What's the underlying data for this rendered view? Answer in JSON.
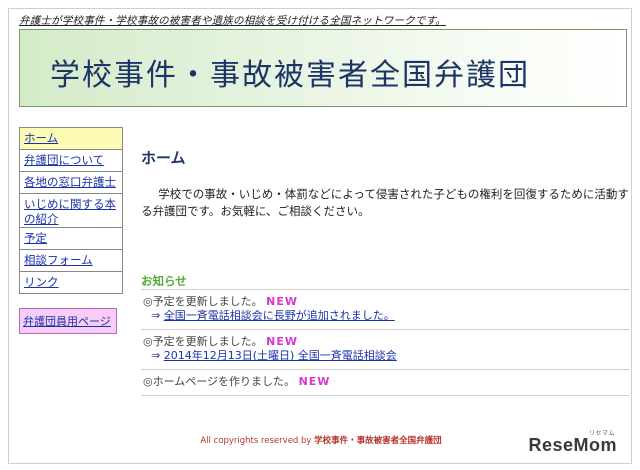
{
  "header": {
    "tagline": "弁護士が学校事件・学校事故の被害者や遺族の相談を受け付ける全国ネットワークです。",
    "title": "学校事件・事故被害者全国弁護団"
  },
  "sidebar": {
    "items": [
      {
        "label": "ホーム"
      },
      {
        "label": "弁護団について"
      },
      {
        "label": "各地の窓口弁護士"
      },
      {
        "label": "いじめに関する本の紹介"
      },
      {
        "label": "予定"
      },
      {
        "label": "相談フォーム"
      },
      {
        "label": "リンク"
      }
    ],
    "member_button": "弁護団員用ページ"
  },
  "main": {
    "title": "ホーム",
    "intro": "学校での事故・いじめ・体罰などによって侵害された子どもの権利を回復するために活動する弁護団です。お気軽に、ご相談ください。"
  },
  "news": {
    "heading": "お知らせ",
    "new_label": "NEW",
    "items": [
      {
        "text": "◎予定を更新しました。",
        "arrow": "⇒",
        "link": "全国一斉電話相談会に長野が追加されました。"
      },
      {
        "text": "◎予定を更新しました。",
        "arrow": "⇒",
        "link": "2014年12月13日(土曜日) 全国一斉電話相談会"
      },
      {
        "text": "◎ホームページを作りました。"
      }
    ]
  },
  "footer": {
    "prefix": "All copyrights reserved by",
    "owner": "学校事件・事故被害者全国弁護団"
  },
  "watermark": {
    "logo": "ReseMom",
    "sub": "リセマム"
  },
  "colors": {
    "accent_link": "#1a33a8",
    "new_badge": "#d33bd0",
    "news_heading": "#55a83a",
    "banner_title": "#1d3566"
  }
}
